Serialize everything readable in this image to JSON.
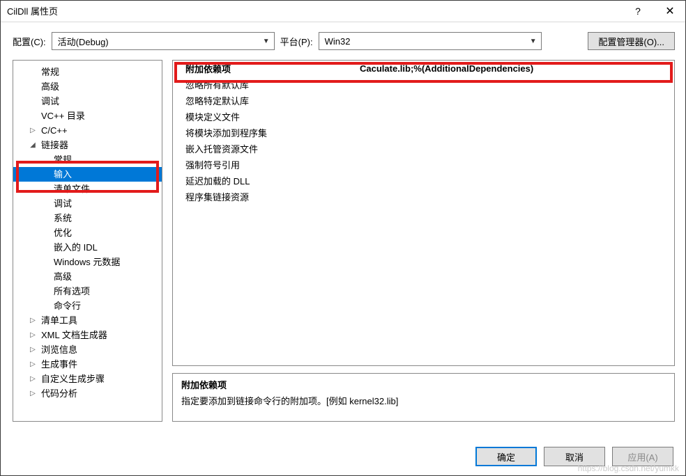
{
  "window": {
    "title": "CilDll 属性页"
  },
  "config": {
    "label": "配置(C):",
    "value": "活动(Debug)",
    "platform_label": "平台(P):",
    "platform_value": "Win32",
    "manager_button": "配置管理器(O)..."
  },
  "tree": {
    "items": [
      {
        "label": "常规",
        "depth": 0,
        "exp": ""
      },
      {
        "label": "高级",
        "depth": 0,
        "exp": ""
      },
      {
        "label": "调试",
        "depth": 0,
        "exp": ""
      },
      {
        "label": "VC++ 目录",
        "depth": 0,
        "exp": ""
      },
      {
        "label": "C/C++",
        "depth": 0,
        "exp": "▷"
      },
      {
        "label": "链接器",
        "depth": 0,
        "exp": "◢"
      },
      {
        "label": "常规",
        "depth": 1,
        "exp": ""
      },
      {
        "label": "输入",
        "depth": 1,
        "exp": "",
        "selected": true
      },
      {
        "label": "清单文件",
        "depth": 1,
        "exp": ""
      },
      {
        "label": "调试",
        "depth": 1,
        "exp": ""
      },
      {
        "label": "系统",
        "depth": 1,
        "exp": ""
      },
      {
        "label": "优化",
        "depth": 1,
        "exp": ""
      },
      {
        "label": "嵌入的 IDL",
        "depth": 1,
        "exp": ""
      },
      {
        "label": "Windows 元数据",
        "depth": 1,
        "exp": ""
      },
      {
        "label": "高级",
        "depth": 1,
        "exp": ""
      },
      {
        "label": "所有选项",
        "depth": 1,
        "exp": ""
      },
      {
        "label": "命令行",
        "depth": 1,
        "exp": ""
      },
      {
        "label": "清单工具",
        "depth": 0,
        "exp": "▷"
      },
      {
        "label": "XML 文档生成器",
        "depth": 0,
        "exp": "▷"
      },
      {
        "label": "浏览信息",
        "depth": 0,
        "exp": "▷"
      },
      {
        "label": "生成事件",
        "depth": 0,
        "exp": "▷"
      },
      {
        "label": "自定义生成步骤",
        "depth": 0,
        "exp": "▷"
      },
      {
        "label": "代码分析",
        "depth": 0,
        "exp": "▷"
      }
    ]
  },
  "properties": [
    {
      "key": "附加依赖项",
      "value": "Caculate.lib;%(AdditionalDependencies)",
      "highlight": true
    },
    {
      "key": "忽略所有默认库",
      "value": ""
    },
    {
      "key": "忽略特定默认库",
      "value": ""
    },
    {
      "key": "模块定义文件",
      "value": ""
    },
    {
      "key": "将模块添加到程序集",
      "value": ""
    },
    {
      "key": "嵌入托管资源文件",
      "value": ""
    },
    {
      "key": "强制符号引用",
      "value": ""
    },
    {
      "key": "延迟加载的 DLL",
      "value": ""
    },
    {
      "key": "程序集链接资源",
      "value": ""
    }
  ],
  "description": {
    "heading": "附加依赖项",
    "body": "指定要添加到链接命令行的附加项。[例如 kernel32.lib]"
  },
  "buttons": {
    "ok": "确定",
    "cancel": "取消",
    "apply": "应用(A)"
  },
  "watermark": "https://blog.csdn.net/yumkk"
}
